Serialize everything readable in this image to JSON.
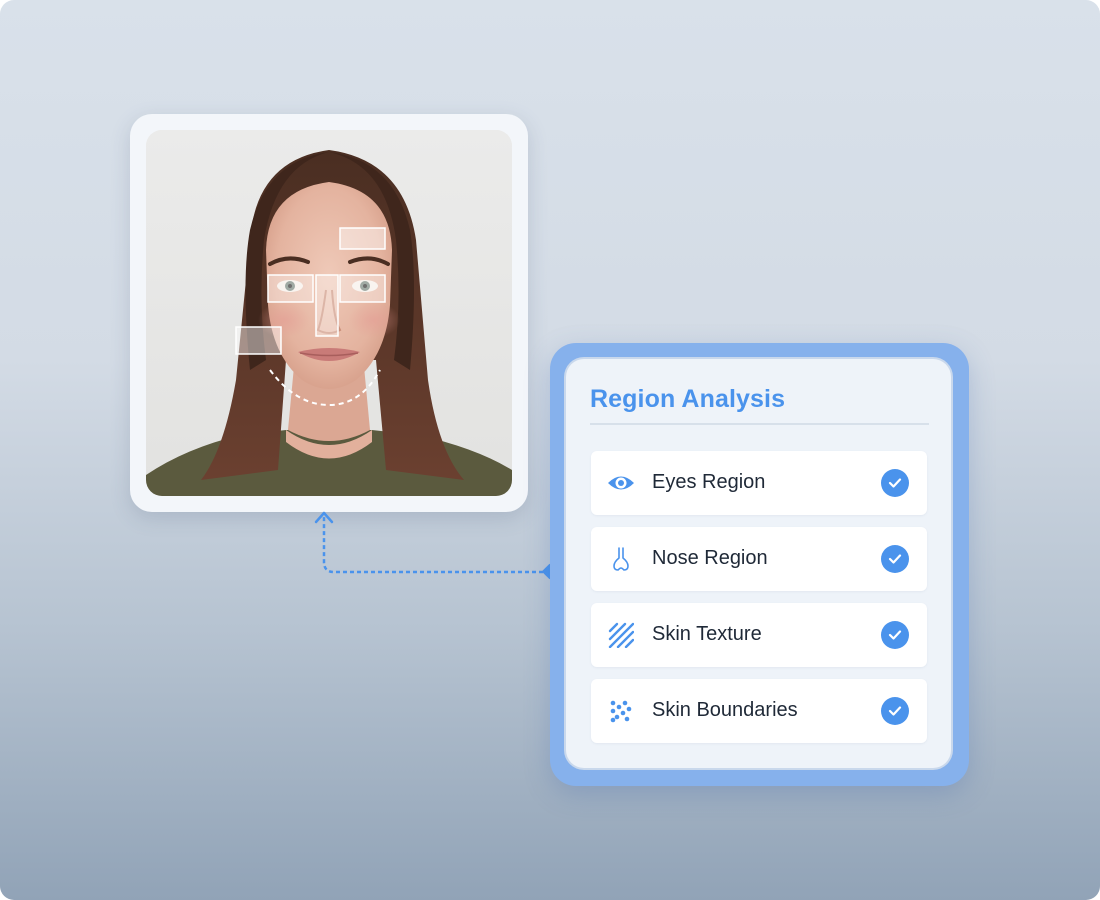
{
  "panel": {
    "title": "Region Analysis",
    "items": [
      {
        "label": "Eyes Region",
        "icon": "eye-icon",
        "status": "checked"
      },
      {
        "label": "Nose Region",
        "icon": "nose-icon",
        "status": "checked"
      },
      {
        "label": "Skin Texture",
        "icon": "texture-icon",
        "status": "checked"
      },
      {
        "label": "Skin Boundaries",
        "icon": "dots-icon",
        "status": "checked"
      }
    ]
  },
  "photo": {
    "subject": "face-portrait",
    "overlays": [
      "forehead-box",
      "left-eye-box",
      "right-eye-box",
      "nose-box",
      "cheek-box",
      "jawline-curve"
    ]
  },
  "colors": {
    "accent": "#4a93ec",
    "panel_frame": "#86b1ec",
    "panel_bg": "#eef3f9"
  }
}
